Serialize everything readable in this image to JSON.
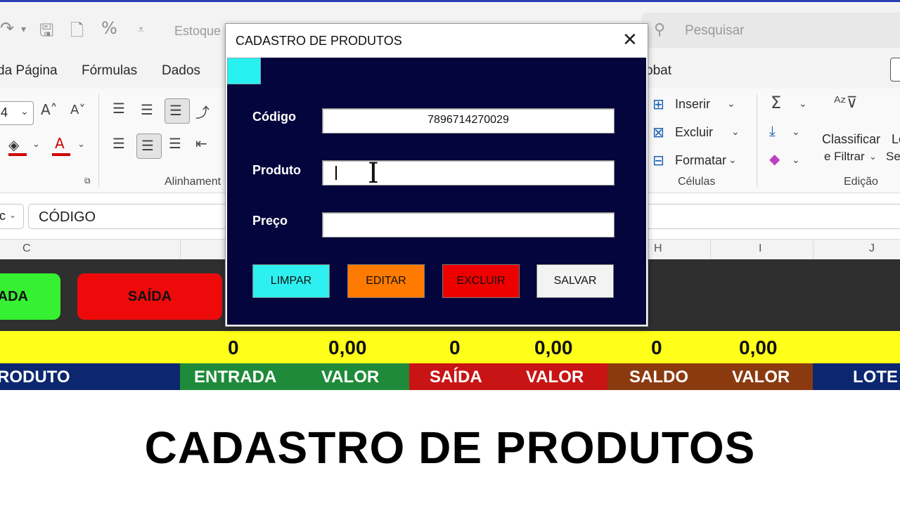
{
  "quick_access": {
    "file_title": "Estoque",
    "search_placeholder": "Pesquisar"
  },
  "ribbon_tabs": [
    "da Página",
    "Fórmulas",
    "Dados",
    "obat"
  ],
  "ribbon": {
    "font_size": "4",
    "alignment_label": "Alinhament",
    "cells_group": {
      "insert": "Inserir",
      "delete": "Excluir",
      "format": "Formatar",
      "label": "Células"
    },
    "editing_group": {
      "sort_line1": "Classificar",
      "sort_line2": "e Filtrar",
      "find_line1": "Lo",
      "find_line2": "Se",
      "label": "Edição"
    }
  },
  "formula_bar": {
    "name_box": "c",
    "content": "CÓDIGO"
  },
  "columns": [
    "C",
    "H",
    "I",
    "J"
  ],
  "sheet": {
    "entrada_button": "ADA",
    "saida_button": "SAÍDA",
    "totals": [
      "0",
      "0,00",
      "0",
      "0,00",
      "0",
      "0,00"
    ],
    "headers": [
      "RODUTO",
      "ENTRADA",
      "VALOR",
      "SAÍDA",
      "VALOR",
      "SALDO",
      "VALOR",
      "LOTE"
    ]
  },
  "colors": {
    "dialog_bg": "#05053d",
    "limpar": "#2ff0f0",
    "editar": "#ff7a00",
    "excluir": "#ee0000",
    "salvar": "#f3f3f3",
    "entrada_green": "#1f8b3a",
    "saida_red": "#c81414",
    "saldo_brown": "#8b3a10",
    "navy": "#0c2770"
  },
  "dialog": {
    "title": "CADASTRO DE PRODUTOS",
    "close_glyph": "✕",
    "codigo_label": "Código",
    "codigo_value": "7896714270029",
    "produto_label": "Produto",
    "produto_value": "",
    "preco_label": "Preço",
    "preco_value": "",
    "buttons": {
      "limpar": "LIMPAR",
      "editar": "EDITAR",
      "excluir": "EXCLUIR",
      "salvar": "SALVAR"
    }
  },
  "caption": "CADASTRO DE PRODUTOS"
}
